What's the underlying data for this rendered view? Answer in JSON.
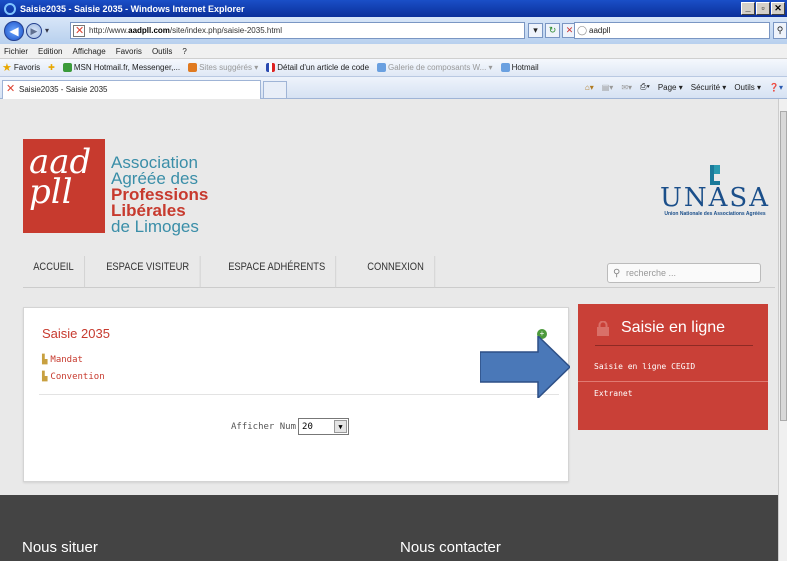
{
  "browser": {
    "window_title": "Saisie2035 - Saisie 2035 - Windows Internet Explorer",
    "url_prefix": "http://www.",
    "url_domain": "aadpll.com",
    "url_path": "/site/index.php/saisie-2035.html",
    "search_value": "aadpll",
    "menu": [
      "Fichier",
      "Edition",
      "Affichage",
      "Favoris",
      "Outils",
      "?"
    ],
    "favorites_label": "Favoris",
    "favorites": [
      {
        "label": "MSN Hotmail.fr, Messenger,...",
        "muted": false
      },
      {
        "label": "Sites suggérés ▾",
        "muted": true
      },
      {
        "label": "Détail d'un article de code",
        "muted": false
      },
      {
        "label": "Galerie de composants W... ▾",
        "muted": true
      },
      {
        "label": "Hotmail",
        "muted": false
      }
    ],
    "tab_title": "Saisie2035 - Saisie 2035",
    "command_bar": [
      "Page ▾",
      "Sécurité ▾",
      "Outils ▾"
    ]
  },
  "site": {
    "logo_script": "aad pll",
    "assoc_lines": [
      "Association",
      "Agréée des"
    ],
    "assoc_bold": [
      "Professions",
      "Libérales"
    ],
    "assoc_last": "de Limoges",
    "unasa_word": "UNASA",
    "unasa_tag": "Union Nationale des Associations Agréées",
    "nav": [
      "ACCUEIL",
      "ESPACE VISITEUR",
      "ESPACE ADHÉRENTS",
      "CONNEXION"
    ],
    "search_placeholder": "recherche ...",
    "content": {
      "title": "Saisie 2035",
      "links": [
        "Mandat",
        "Convention"
      ],
      "afficher_label": "Afficher Num",
      "afficher_value": "20"
    },
    "sidebar": {
      "title": "Saisie en ligne",
      "items": [
        "Saisie en ligne CEGID",
        "Extranet"
      ]
    },
    "footer": {
      "col1": "Nous situer",
      "col2": "Nous contacter"
    }
  },
  "colors": {
    "brand_red": "#c94037",
    "brand_teal": "#3a8ea8",
    "arrow_blue": "#4a78b8"
  }
}
